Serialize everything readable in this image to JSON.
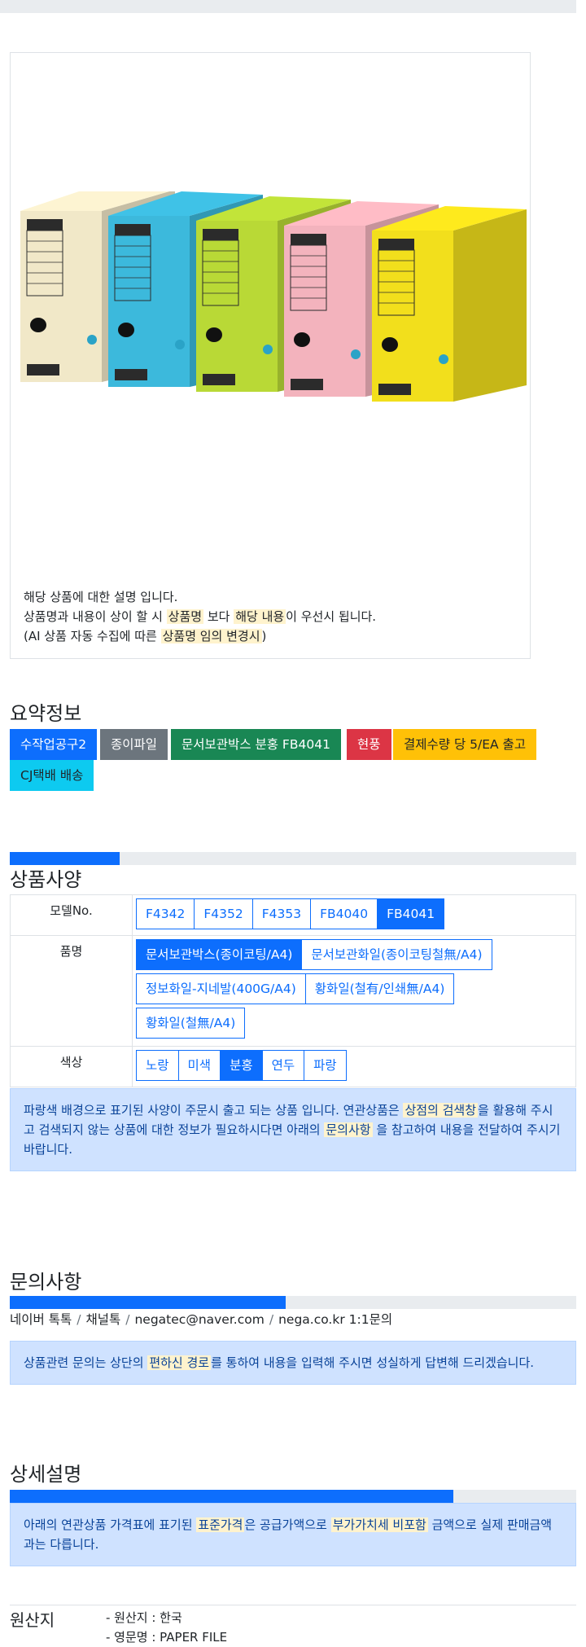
{
  "product": {
    "image_alt": "문서보관박스 제품 사진",
    "box_colors": [
      "#f1e8c8",
      "#3cb9dc",
      "#b9d936",
      "#f3b3bd",
      "#f2df1c"
    ],
    "description": {
      "line1": "해당 상품에 대한 설명 입니다.",
      "line2_pre": "상품명과 내용이 상이 할 시 ",
      "line2_hl1": "상품명",
      "line2_mid": " 보다 ",
      "line2_hl2": "해당 내용",
      "line2_post": "이 우선시 됩니다.",
      "line3_pre": "(AI 상품 자동 수집에 따른 ",
      "line3_hl": "상품명 임의 변경시",
      "line3_post": ")"
    }
  },
  "summary": {
    "title": "요약정보",
    "badges": [
      {
        "label": "수작업공구2",
        "color": "#0d6efd"
      },
      {
        "label": "종이파일",
        "color": "#6c757d"
      },
      {
        "label": "문서보관박스 분홍 FB4041",
        "color": "#198754"
      },
      {
        "label": "현풍",
        "color": "#dc3545"
      },
      {
        "label": "결제수량 당 5/EA 출고",
        "color": "#ffc107"
      },
      {
        "label": "CJ택배 배송",
        "color": "#0dcaf0"
      }
    ]
  },
  "spec": {
    "progress_percent": 19.4,
    "title": "상품사양",
    "rows": [
      {
        "label": "모델No.",
        "options": [
          "F4342",
          "F4352",
          "F4353",
          "FB4040",
          "FB4041"
        ],
        "selected": 4
      },
      {
        "label": "품명",
        "options": [
          "문서보관박스(종이코팅/A4)",
          "문서보관화일(종이코팅철無/A4)",
          "정보화일-지네발(400G/A4)",
          "황화일(철有/인쇄無/A4)",
          "황화일(철無/A4)"
        ],
        "selected": 0
      },
      {
        "label": "색상",
        "options": [
          "노랑",
          "미색",
          "분홍",
          "연두",
          "파랑"
        ],
        "selected": 2
      }
    ],
    "notice": {
      "pre": "파랑색 배경으로 표기된 사양이 주문시 출고 되는 상품 입니다. 연관상품은 ",
      "hl1": "상점의 검색창",
      "mid": "을 활용해 주시고 검색되지 않는 상품에 대한 정보가 필요하시다면 아래의 ",
      "hl2": "문의사항",
      "post": " 을 참고하여 내용을 전달하여 주시기 바랍니다."
    }
  },
  "inquiry": {
    "title": "문의사항",
    "progress_percent": 48.7,
    "links": [
      "네이버 톡톡",
      "채널톡",
      "negatec@naver.com",
      "nega.co.kr 1:1문의"
    ],
    "notice": {
      "pre": "상품관련 문의는 상단의 ",
      "hl": "편하신 경로",
      "post": "를 통하여 내용을 입력해 주시면 성실하게 답변해 드리겠습니다."
    }
  },
  "detail": {
    "title": "상세설명",
    "progress_percent": 78.3,
    "notice": {
      "pre": "아래의 연관상품 가격표에 표기된 ",
      "hl1": "표준가격",
      "mid": "은 공급가액으로 ",
      "hl2": "부가가치세 비포함",
      "post": " 금액으로 실제 판매금액과는 다릅니다."
    }
  },
  "origin": {
    "label": "원산지",
    "lines": [
      "- 원산지 : 한국",
      "- 영문명 : PAPER FILE"
    ]
  }
}
